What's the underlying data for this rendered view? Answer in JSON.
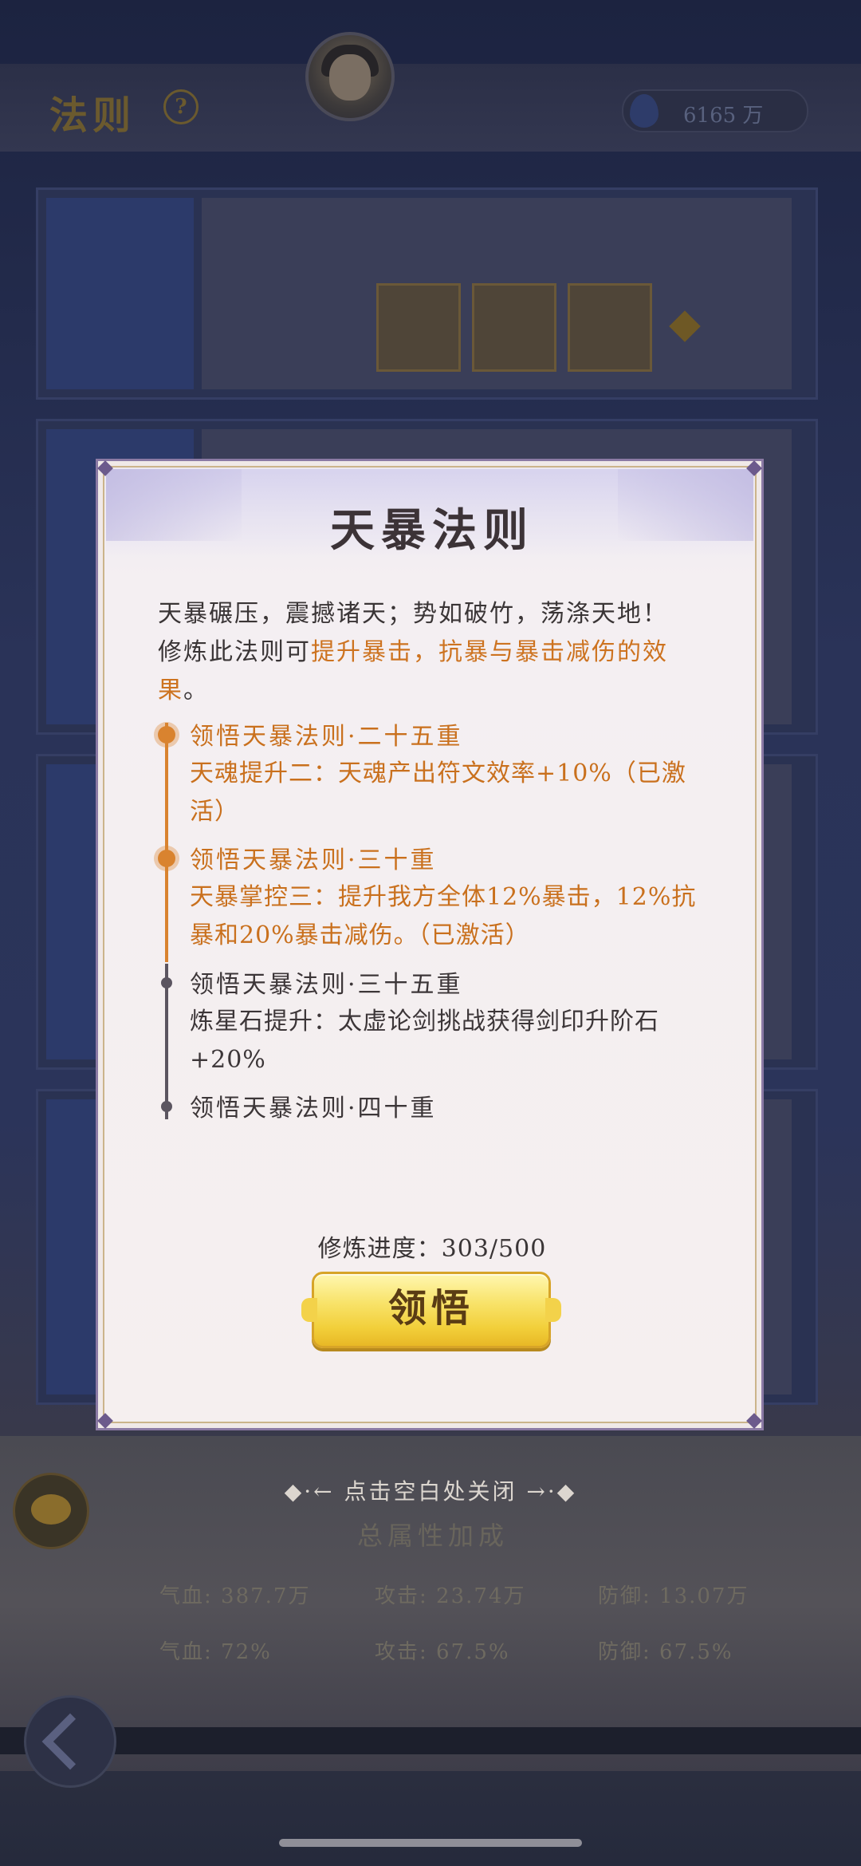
{
  "background": {
    "page_title": "法则",
    "help_icon": "?",
    "currency_value": "6165 万",
    "bottom_title": "总属性加成",
    "stats_row1": [
      "气血: 387.7万",
      "攻击: 23.74万",
      "防御: 13.07万"
    ],
    "stats_row2": [
      "气血: 72%",
      "攻击: 67.5%",
      "防御: 67.5%"
    ]
  },
  "modal": {
    "title": "天暴法则",
    "desc_line1": "天暴碾压，震撼诸天；势如破竹，荡涤天地！",
    "desc_prefix": "修炼此法则可",
    "desc_highlight": "提升暴击，抗暴与暴击减伤的效果",
    "desc_suffix": "。",
    "milestones": [
      {
        "title": "领悟天暴法则·二十五重",
        "effect": "天魂提升二：天魂产出符文效率+10%（已激活）",
        "state": "active"
      },
      {
        "title": "领悟天暴法则·三十重",
        "effect": "天暴掌控三：提升我方全体12%暴击，12%抗暴和20%暴击减伤。（已激活）",
        "state": "active"
      },
      {
        "title": "领悟天暴法则·三十五重",
        "effect": "炼星石提升：太虚论剑挑战获得剑印升阶石+20%",
        "state": "inactive"
      },
      {
        "title": "领悟天暴法则·四十重",
        "effect": "",
        "state": "inactive"
      }
    ],
    "progress_label": "修炼进度：303/500",
    "progress": {
      "current": 303,
      "total": 500
    },
    "action_button": "领悟"
  },
  "close_hint": "◆·← 点击空白处关闭 →·◆",
  "colors": {
    "active": "#c9701d",
    "inactive": "#3c3638",
    "button": "#f2cf3a"
  }
}
